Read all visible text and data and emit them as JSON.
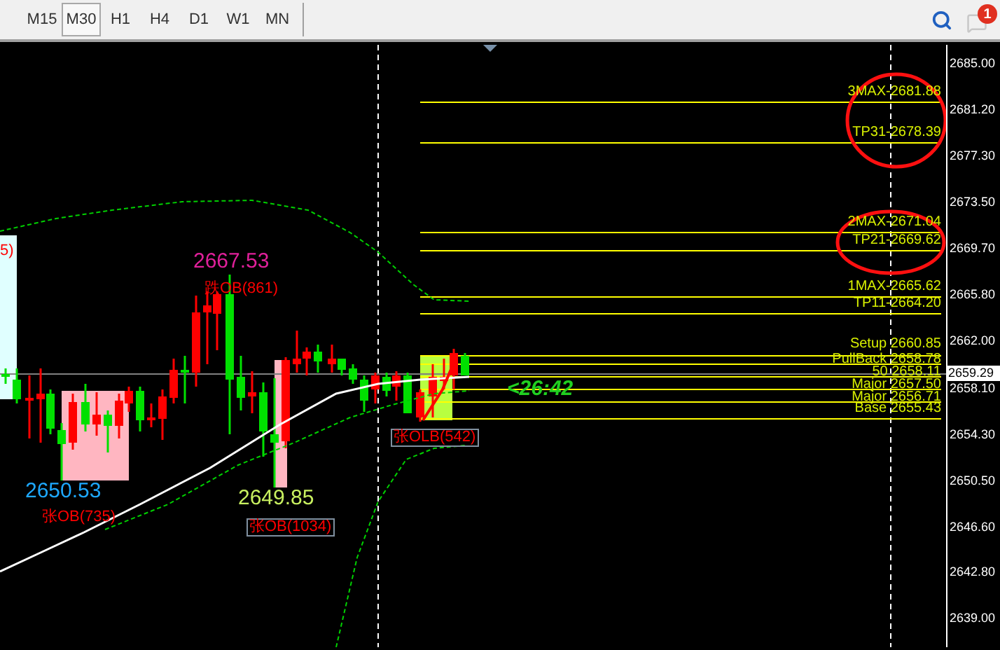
{
  "toolbar": {
    "timeframes": [
      {
        "label": "M15",
        "selected": false
      },
      {
        "label": "M30",
        "selected": true
      },
      {
        "label": "H1",
        "selected": false
      },
      {
        "label": "H4",
        "selected": false
      },
      {
        "label": "D1",
        "selected": false
      },
      {
        "label": "W1",
        "selected": false
      },
      {
        "label": "MN",
        "selected": false
      }
    ],
    "notification_badge": "1"
  },
  "chart": {
    "price_axis": [
      "2685.00",
      "2681.20",
      "2677.30",
      "2673.50",
      "2669.70",
      "2665.80",
      "2662.00",
      "2658.10",
      "2654.30",
      "2650.50",
      "2646.60",
      "2642.80",
      "2639.00"
    ],
    "current_price": "2659.29",
    "levels": [
      {
        "label": "3MAX-2681.88"
      },
      {
        "label": "TP31-2678.39"
      },
      {
        "label": "2MAX-2671.04"
      },
      {
        "label": "TP21-2669.62"
      },
      {
        "label": "1MAX-2665.62"
      },
      {
        "label": "TP11-2664.20"
      },
      {
        "label": "Setup 2660.85"
      },
      {
        "label": "PullBack 2658.78"
      },
      {
        "label": "50 2658.11"
      },
      {
        "label": "Major 2657.50"
      },
      {
        "label": "Major 2656.71"
      },
      {
        "label": "Base 2655.43"
      }
    ],
    "annotations": [
      {
        "text": "5)",
        "kind": "signal",
        "color": "#ff0000"
      },
      {
        "text": "2667.53",
        "kind": "price",
        "color": "#e0209a"
      },
      {
        "text": "跌OB(861)",
        "kind": "signal",
        "color": "#ff0000"
      },
      {
        "text": "2650.53",
        "kind": "price",
        "color": "#1ea8ff"
      },
      {
        "text": "张OB(735)",
        "kind": "signal",
        "color": "#ff0000"
      },
      {
        "text": "2649.85",
        "kind": "price",
        "color": "#c8f060"
      },
      {
        "text": "张OB(1034)",
        "kind": "signal-boxed",
        "color": "#ff0000"
      },
      {
        "text": "张OLB(542)",
        "kind": "signal-boxed",
        "color": "#ff0000"
      }
    ],
    "countdown": "<26:42"
  }
}
